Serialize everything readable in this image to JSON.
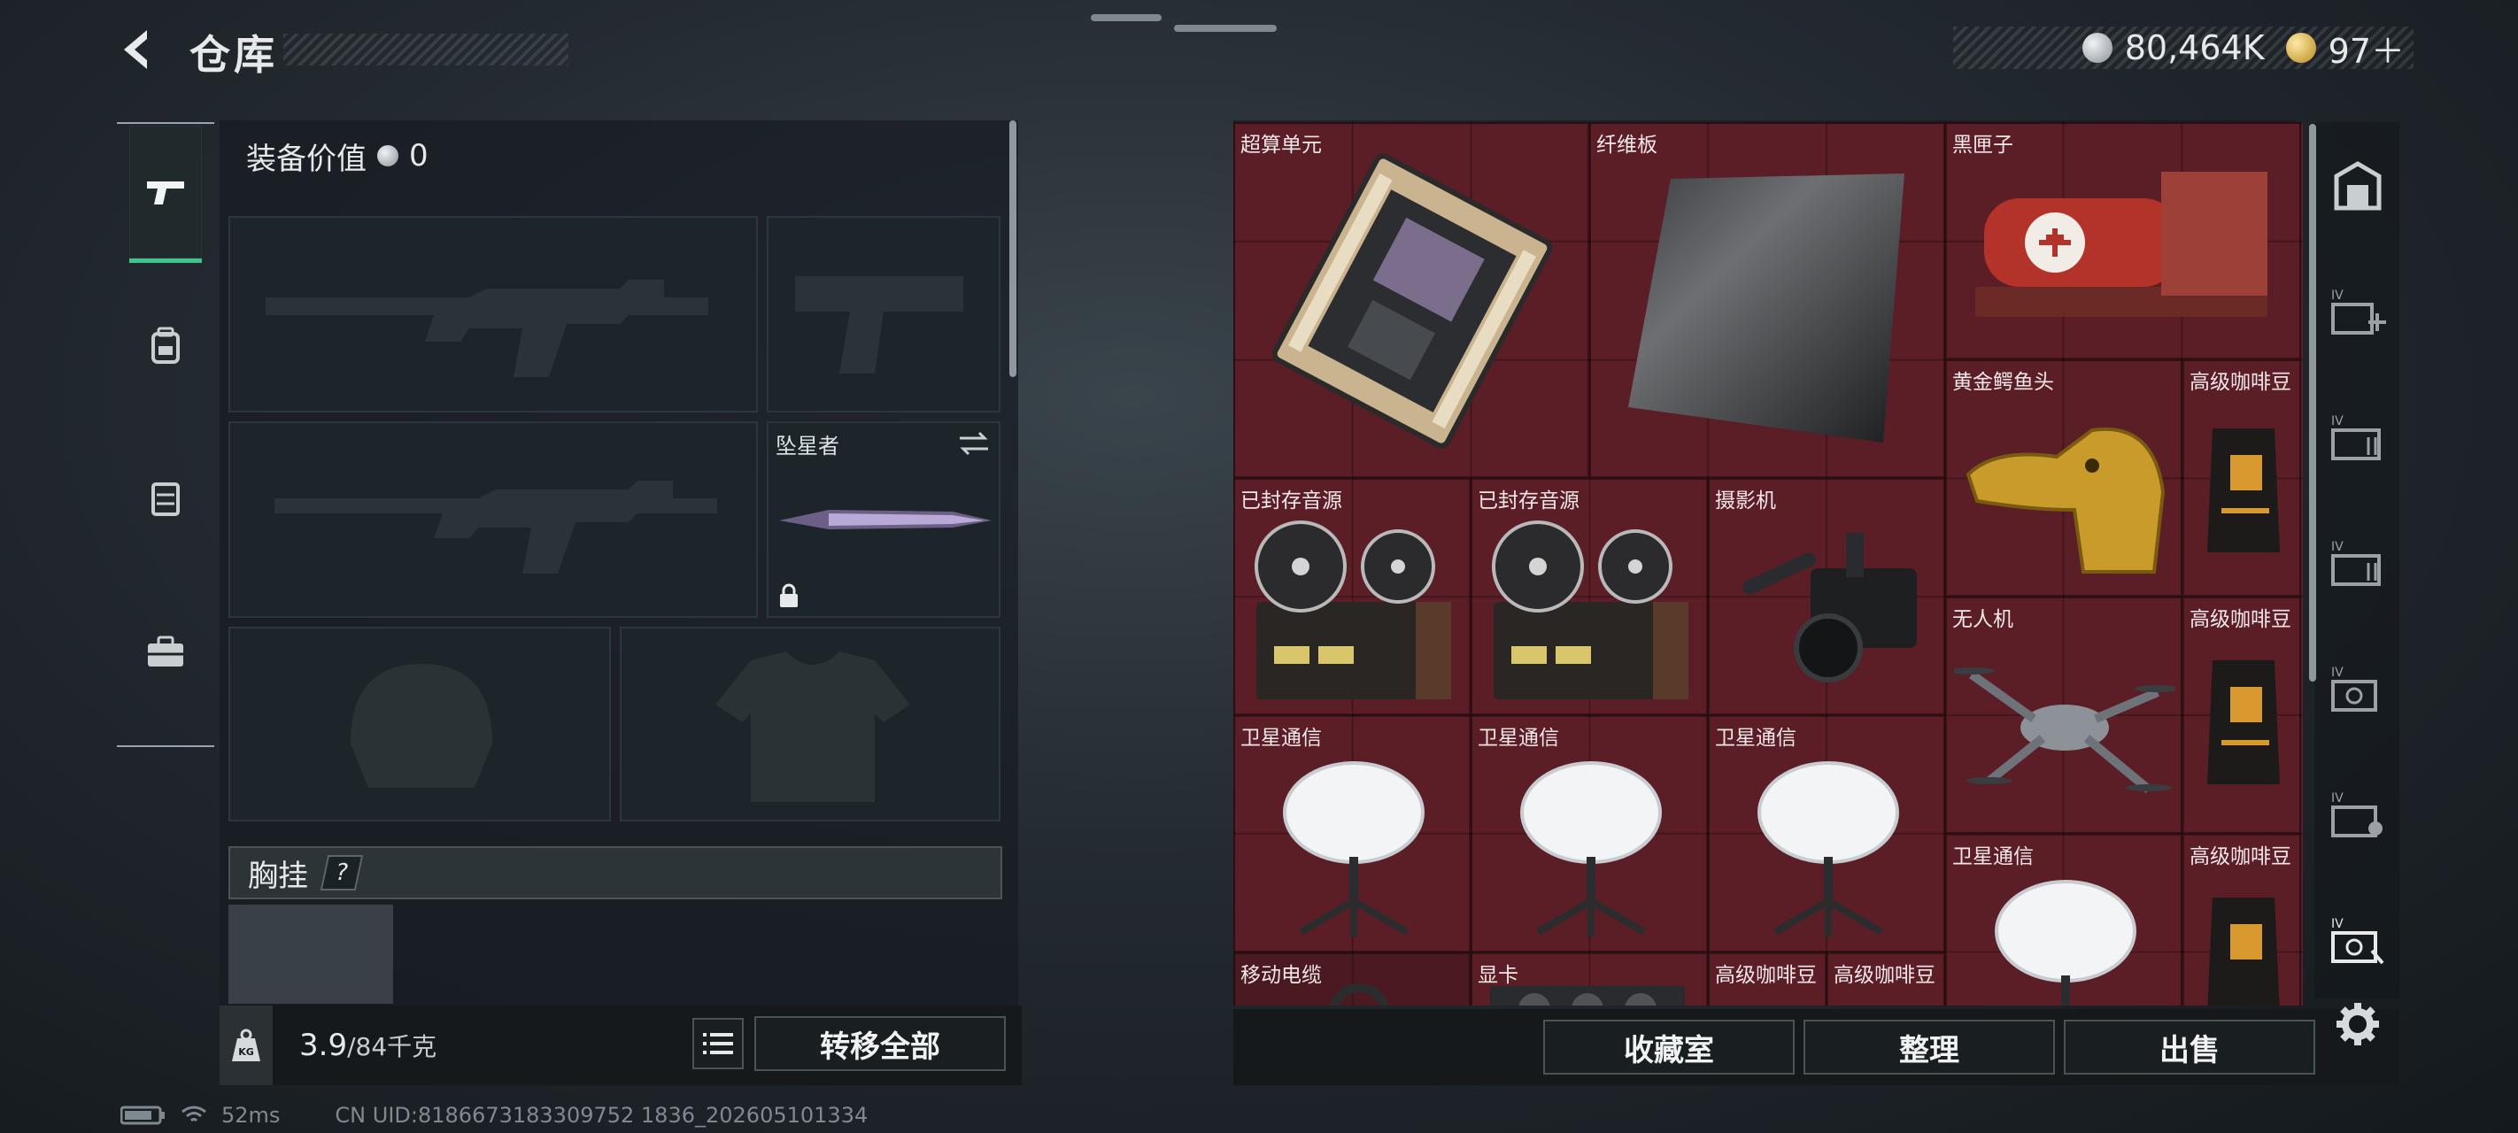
{
  "header": {
    "title": "仓库",
    "currency_silver": "80,464K",
    "currency_gold": "97＋"
  },
  "left_tabs": [
    "weapon-icon",
    "backpack-icon",
    "vest-icon",
    "toolbox-icon"
  ],
  "equipment": {
    "value_label": "装备价值",
    "value": "0",
    "melee_label": "坠星者",
    "chest_label": "胸挂",
    "chest_help": "?"
  },
  "bottom_left": {
    "weight_current": "3.9",
    "weight_max": "/84千克",
    "weight_unit_icon": "KG",
    "transfer_all": "转移全部"
  },
  "items": [
    {
      "label": "超算单元"
    },
    {
      "label": "纤维板"
    },
    {
      "label": "黑匣子"
    },
    {
      "label": "黄金鳄鱼头"
    },
    {
      "label": "高级咖啡豆"
    },
    {
      "label": "已封存音源"
    },
    {
      "label": "已封存音源"
    },
    {
      "label": "摄影机"
    },
    {
      "label": "无人机"
    },
    {
      "label": "高级咖啡豆"
    },
    {
      "label": "卫星通信"
    },
    {
      "label": "卫星通信"
    },
    {
      "label": "卫星通信"
    },
    {
      "label": "卫星通信"
    },
    {
      "label": "高级咖啡豆"
    },
    {
      "label": "移动电缆"
    },
    {
      "label": "显卡"
    },
    {
      "label": "高级咖啡豆"
    },
    {
      "label": "高级咖啡豆"
    }
  ],
  "bottom_right": {
    "collection": "收藏室",
    "organize": "整理",
    "sell": "出售"
  },
  "right_rail": [
    "safe-icon",
    "iv-add-icon",
    "iv-container-icon",
    "iv-container-icon",
    "iv-camera-icon",
    "iv-lock-icon",
    "iv-box-icon",
    "settings-icon"
  ],
  "status": {
    "ping": "52ms",
    "uid": "CN UID:8186673183309752 1836_202605101334"
  }
}
